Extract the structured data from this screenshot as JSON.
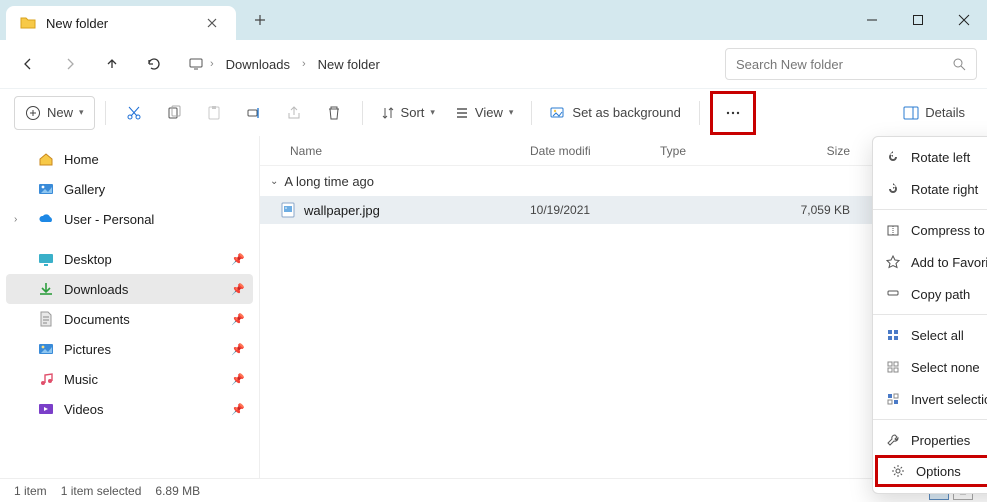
{
  "titlebar": {
    "title": "New folder"
  },
  "nav": {
    "crumb1": "Downloads",
    "crumb2": "New folder"
  },
  "search": {
    "placeholder": "Search New folder"
  },
  "toolbar": {
    "new": "New",
    "sort": "Sort",
    "view": "View",
    "setbg": "Set as background",
    "details": "Details"
  },
  "sidebar": {
    "home": "Home",
    "gallery": "Gallery",
    "user": "User - Personal",
    "desktop": "Desktop",
    "downloads": "Downloads",
    "documents": "Documents",
    "pictures": "Pictures",
    "music": "Music",
    "videos": "Videos"
  },
  "columns": {
    "name": "Name",
    "date": "Date modifi",
    "type": "Type",
    "size": "Size"
  },
  "group": {
    "label": "A long time ago"
  },
  "files": {
    "f0": {
      "name": "wallpaper.jpg",
      "date": "10/19/2021",
      "size": "7,059 KB"
    }
  },
  "menu": {
    "rotate_left": "Rotate left",
    "rotate_right": "Rotate right",
    "compress": "Compress to ZIP file",
    "favorites": "Add to Favorites",
    "copypath": "Copy path",
    "selectall": "Select all",
    "selectnone": "Select none",
    "invert": "Invert selection",
    "properties": "Properties",
    "options": "Options"
  },
  "status": {
    "count": "1 item",
    "selected": "1 item selected",
    "size": "6.89 MB"
  }
}
